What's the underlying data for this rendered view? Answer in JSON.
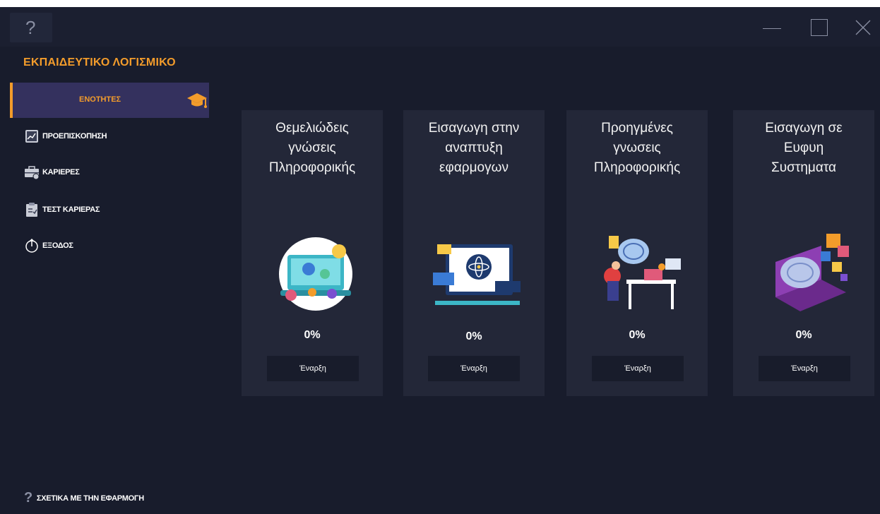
{
  "titlebar": {
    "help": "?",
    "controls": [
      "minimize-icon",
      "maximize-icon",
      "close-icon"
    ]
  },
  "app_title": "ΕΚΠΑΙΔΕΥΤΙΚΟ ΛΟΓΙΣΜΙΚΟ",
  "sidebar": {
    "active": {
      "label": "ΕΝΟΤΗΤΕΣ",
      "icon": "graduation-cap-icon"
    },
    "items": [
      {
        "label": "ΠΡΟΕΠΙΣΚΟΠΗΣΗ",
        "icon": "chart-icon"
      },
      {
        "label": "ΚΑΡΙΕΡΕΣ",
        "icon": "briefcase-icon"
      },
      {
        "label": "ΤΕΣΤ ΚΑΡΙΕΡΑΣ",
        "icon": "clipboard-icon"
      },
      {
        "label": "ΕΞΟΔΟΣ",
        "icon": "power-icon"
      }
    ],
    "about": {
      "label": "ΣΧΕΤΙΚΑ ΜΕ ΤΗΝ ΕΦΑΡΜΟΓΗ",
      "icon": "question-icon"
    }
  },
  "cards": [
    {
      "title_lines": [
        "Θεμελιώδεις",
        "γνώσεις",
        "Πληροφορικής"
      ],
      "progress": "0%",
      "button": "Έναρξη",
      "illustration": "coding-illustration-icon"
    },
    {
      "title_lines": [
        "Εισαγωγη στην",
        "αναπτυξη",
        "εφαρμογων"
      ],
      "progress": "0%",
      "button": "Έναρξη",
      "illustration": "app-development-illustration-icon"
    },
    {
      "title_lines": [
        "Προηγμένες",
        "γνωσεις",
        "Πληροφορικής"
      ],
      "progress": "0%",
      "button": "Έναρξη",
      "illustration": "advanced-computing-illustration-icon"
    },
    {
      "title_lines": [
        "Εισαγωγη σε",
        "Ευφυη",
        "Συστηματα"
      ],
      "progress": "0%",
      "button": "Έναρξη",
      "illustration": "ai-brain-illustration-icon"
    }
  ],
  "colors": {
    "background": "#181c2c",
    "card": "#232738",
    "accent": "#f39c2b",
    "active_nav": "#34315e"
  }
}
